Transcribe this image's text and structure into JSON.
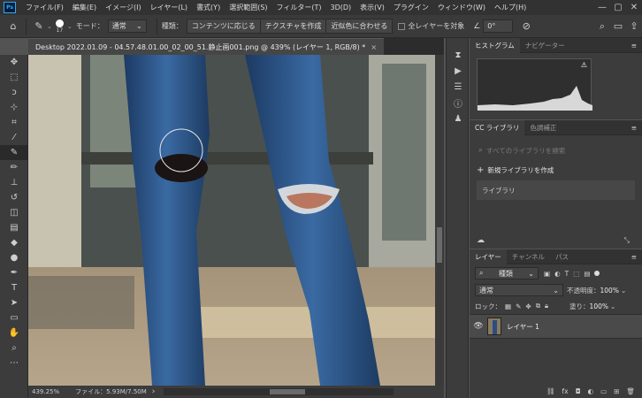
{
  "app": {
    "logo": "Ps"
  },
  "menu": {
    "items": [
      "ファイル(F)",
      "編集(E)",
      "イメージ(I)",
      "レイヤー(L)",
      "書式(Y)",
      "選択範囲(S)",
      "フィルター(T)",
      "3D(D)",
      "表示(V)",
      "プラグイン",
      "ウィンドウ(W)",
      "ヘルプ(H)"
    ],
    "window_controls": [
      "—",
      "▢",
      "✕"
    ]
  },
  "options": {
    "brush_size": "17",
    "mode_label": "モード：",
    "mode_value": "通常",
    "type_label": "種類：",
    "type_buttons": [
      "コンテンツに応じる",
      "テクスチャを作成",
      "近似色に合わせる"
    ],
    "sample_all_layers": "全レイヤーを対象",
    "angle_value": "0°"
  },
  "document": {
    "tab_title": "Desktop 2022.01.09 - 04.57.48.01.00_02_00_51.静止画001.png @ 439% (レイヤー 1, RGB/8) *",
    "close": "×"
  },
  "status": {
    "zoom": "439.25%",
    "file_info": "ファイル：5.93M/7.50M",
    "arrow": "›"
  },
  "histogram_panel": {
    "tabs": [
      "ヒストグラム",
      "ナビゲーター"
    ],
    "warning": "⚠"
  },
  "library_panel": {
    "tabs": [
      "CC ライブラリ",
      "色調補正"
    ],
    "search_placeholder": "すべてのライブラリを検索",
    "create_label": "新規ライブラリを作成",
    "library_name": "ライブラリ"
  },
  "layers_panel": {
    "tabs": [
      "レイヤー",
      "チャンネル",
      "パス"
    ],
    "filter_kind": "種類",
    "blend_mode": "通常",
    "opacity_label": "不透明度：",
    "opacity_value": "100%",
    "lock_label": "ロック：",
    "fill_label": "塗り：",
    "fill_value": "100%",
    "layers": [
      {
        "name": "レイヤー 1",
        "visible": true
      }
    ],
    "footer_fx": "fx"
  },
  "colors": {
    "accent": "#31a8ff",
    "panel_bg": "#3c3c3c",
    "menubar_bg": "#323232"
  }
}
